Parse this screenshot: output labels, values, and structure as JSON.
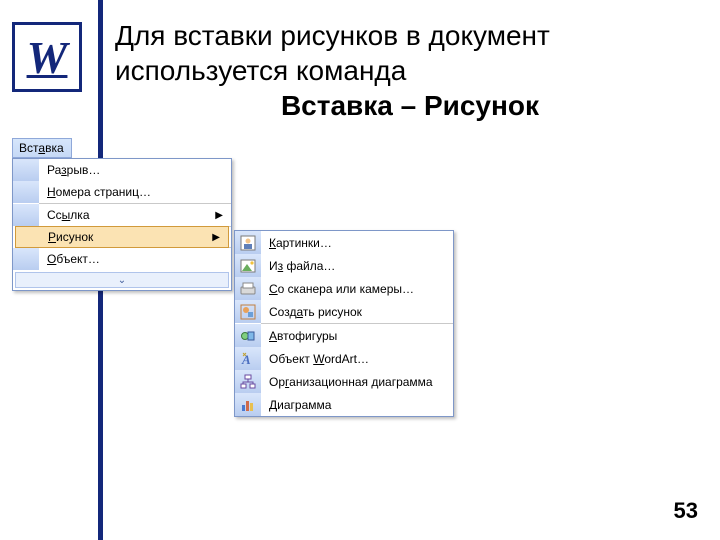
{
  "logo": {
    "letter": "W"
  },
  "heading": {
    "line1": "Для вставки рисунков в документ",
    "line2": "используется команда",
    "line3": "Вставка – Рисунок"
  },
  "menu": {
    "title_pre": "Вст",
    "title_u": "а",
    "title_post": "вка",
    "items": [
      {
        "pre": "Ра",
        "u": "з",
        "post": "рыв…",
        "arrow": false
      },
      {
        "pre": "",
        "u": "Н",
        "post": "омера страниц…",
        "arrow": false
      },
      {
        "pre": "Сс",
        "u": "ы",
        "post": "лка",
        "arrow": true
      },
      {
        "pre": "",
        "u": "Р",
        "post": "исунок",
        "arrow": true,
        "highlight": true
      },
      {
        "pre": "",
        "u": "О",
        "post": "бъект…",
        "arrow": false
      }
    ],
    "expand_glyph": "⌄"
  },
  "submenu": {
    "items": [
      {
        "pre": "",
        "u": "К",
        "post": "артинки…"
      },
      {
        "pre": "И",
        "u": "з",
        "post": " файла…"
      },
      {
        "pre": "",
        "u": "С",
        "post": "о сканера или камеры…"
      },
      {
        "pre": "Созд",
        "u": "а",
        "post": "ть рисунок"
      },
      {
        "pre": "",
        "u": "А",
        "post": "втофигуры"
      },
      {
        "pre": "Объект ",
        "u": "W",
        "post": "ordArt…"
      },
      {
        "pre": "Ор",
        "u": "г",
        "post": "анизационная диаграмма"
      },
      {
        "pre": "",
        "u": "Д",
        "post": "иаграмма"
      }
    ]
  },
  "page_number": "53"
}
